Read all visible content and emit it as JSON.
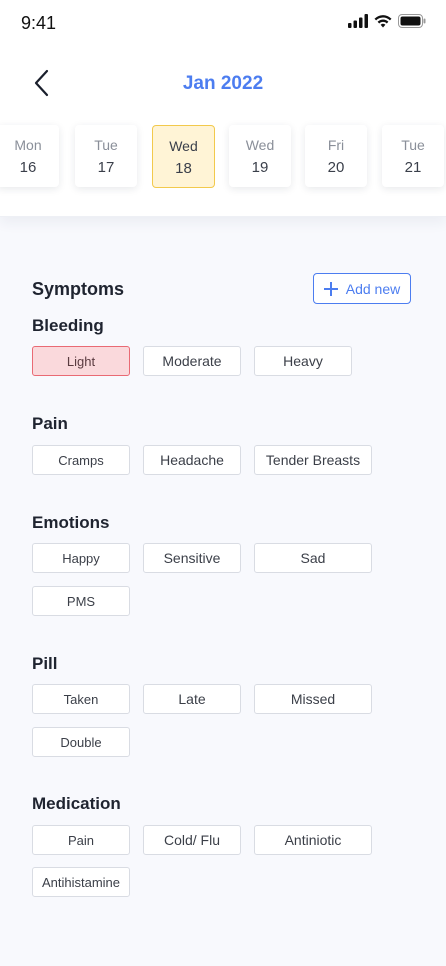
{
  "status": {
    "time": "9:41"
  },
  "header": {
    "month": "Jan 2022"
  },
  "dates": [
    {
      "day": "Mon",
      "date": "16",
      "selected": false
    },
    {
      "day": "Tue",
      "date": "17",
      "selected": false
    },
    {
      "day": "Wed",
      "date": "18",
      "selected": true
    },
    {
      "day": "Wed",
      "date": "19",
      "selected": false
    },
    {
      "day": "Fri",
      "date": "20",
      "selected": false
    },
    {
      "day": "Tue",
      "date": "21",
      "selected": false
    }
  ],
  "symptoms": {
    "title": "Symptoms",
    "add_label": "Add new"
  },
  "sections": {
    "bleeding": {
      "title": "Bleeding",
      "options": [
        "Light",
        "Moderate",
        "Heavy"
      ],
      "selected": "Light"
    },
    "pain": {
      "title": "Pain",
      "options": [
        "Cramps",
        "Headache",
        "Tender Breasts"
      ]
    },
    "emotions": {
      "title": "Emotions",
      "options": [
        "Happy",
        "Sensitive",
        "Sad",
        "PMS"
      ]
    },
    "pill": {
      "title": "Pill",
      "options": [
        "Taken",
        "Late",
        "Missed",
        "Double"
      ]
    },
    "medication": {
      "title": "Medication",
      "options": [
        "Pain",
        "Cold/ Flu",
        "Antiniotic",
        "Antihistamine"
      ]
    }
  },
  "colors": {
    "accent": "#4c7df0",
    "selected_chip": "#fad9dc",
    "selected_date": "#fff4d6"
  }
}
